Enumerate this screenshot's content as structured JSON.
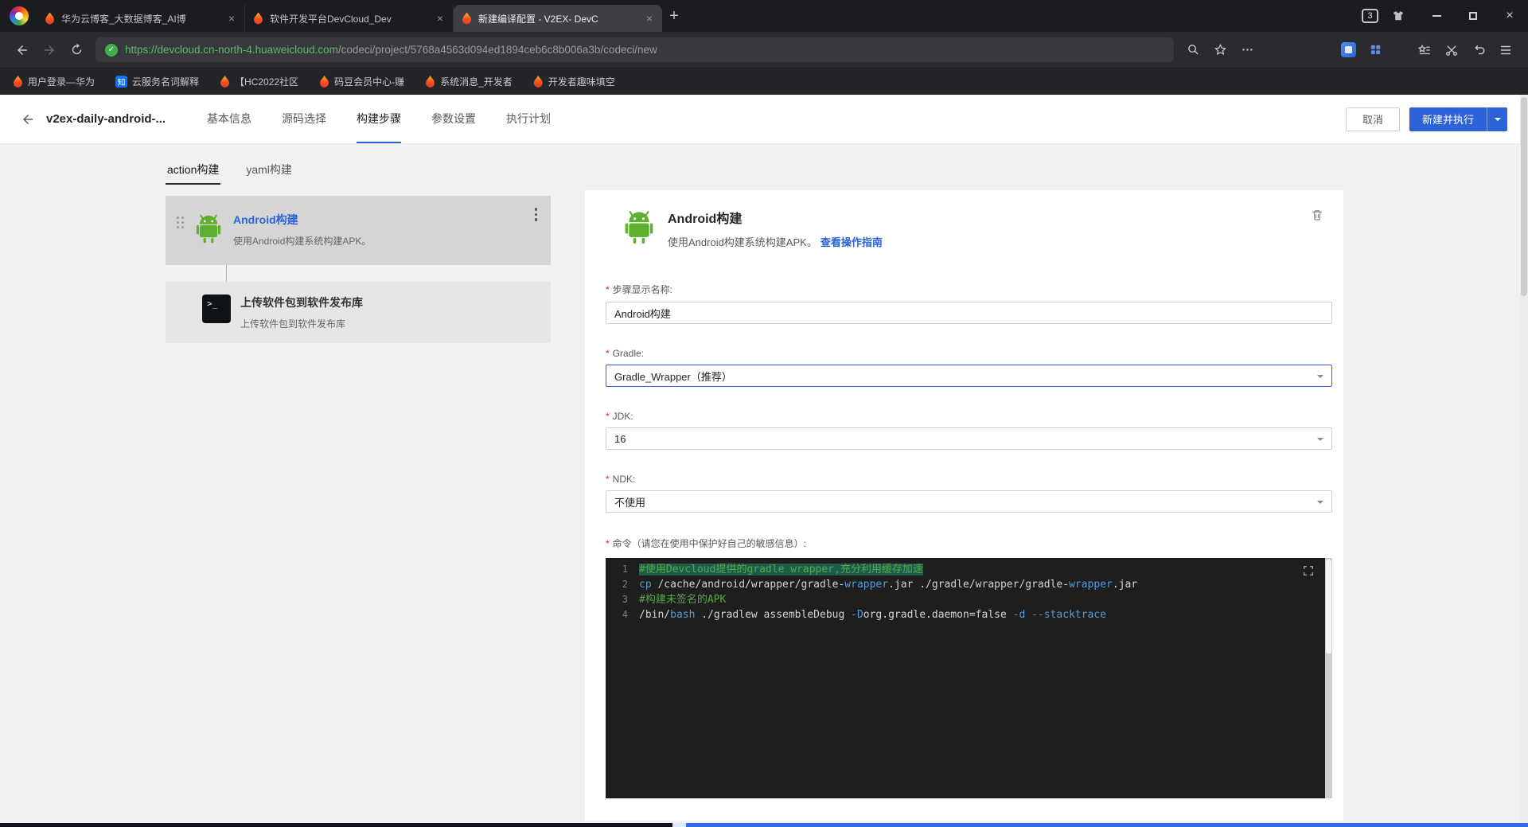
{
  "browser": {
    "tabs": [
      {
        "title": "华为云博客_大数据博客_AI博"
      },
      {
        "title": "软件开发平台DevCloud_Dev"
      },
      {
        "title": "新建编译配置 - V2EX- DevC"
      }
    ],
    "new_tab_label": "+",
    "tab_count_badge": "3",
    "url_secure": "https://devcloud.cn-north-4.huaweicloud.com",
    "url_path": "/codeci/project/5768a4563d094ed1894ceb6c8b006a3b/codeci/new",
    "bookmarks": [
      {
        "label": "用户登录—华为"
      },
      {
        "label": "云服务名词解释",
        "badge": "知"
      },
      {
        "label": "【HC2022社区"
      },
      {
        "label": "码豆会员中心-赚"
      },
      {
        "label": "系统消息_开发者"
      },
      {
        "label": "开发者趣味填空"
      }
    ]
  },
  "page": {
    "header": {
      "title": "v2ex-daily-android-...",
      "nav_tabs": [
        {
          "label": "基本信息"
        },
        {
          "label": "源码选择"
        },
        {
          "label": "构建步骤"
        },
        {
          "label": "参数设置"
        },
        {
          "label": "执行计划"
        }
      ],
      "cancel_label": "取消",
      "primary_label": "新建并执行"
    },
    "mode_tabs": [
      {
        "label": "action构建"
      },
      {
        "label": "yaml构建"
      }
    ],
    "steps": [
      {
        "title": "Android构建",
        "desc": "使用Android构建系统构建APK。"
      },
      {
        "title": "上传软件包到软件发布库",
        "desc": "上传软件包到软件发布库"
      }
    ],
    "detail": {
      "title": "Android构建",
      "desc": "使用Android构建系统构建APK。",
      "guide_link": "查看操作指南",
      "fields": {
        "name": {
          "label": "步骤显示名称:",
          "value": "Android构建"
        },
        "gradle": {
          "label": "Gradle:",
          "value": "Gradle_Wrapper（推荐）"
        },
        "jdk": {
          "label": "JDK:",
          "value": "16"
        },
        "ndk": {
          "label": "NDK:",
          "value": "不使用"
        },
        "command": {
          "label": "命令（请您在使用中保护好自己的敏感信息）:"
        }
      },
      "editor": {
        "lines": [
          {
            "num": "1",
            "segments": [
              {
                "t": "#使用Devcloud提供的gradle wrapper,充分利用缓存加速",
                "c": "cm",
                "sel": true
              }
            ]
          },
          {
            "num": "2",
            "segments": [
              {
                "t": "cp ",
                "c": "kw"
              },
              {
                "t": "/cache/android/wrapper/gradle-",
                "c": "pl"
              },
              {
                "t": "wrapper",
                "c": "kw"
              },
              {
                "t": ".jar ./gradle/wrapper/gradle-",
                "c": "pl"
              },
              {
                "t": "wrapper",
                "c": "kw"
              },
              {
                "t": ".jar",
                "c": "pl"
              }
            ]
          },
          {
            "num": "3",
            "segments": [
              {
                "t": "#构建未签名的APK",
                "c": "cm"
              }
            ]
          },
          {
            "num": "4",
            "segments": [
              {
                "t": "/bin/",
                "c": "pl"
              },
              {
                "t": "bash",
                "c": "kw"
              },
              {
                "t": " ./gradlew assembleDebug ",
                "c": "pl"
              },
              {
                "t": "-D",
                "c": "kw"
              },
              {
                "t": "org.gradle.daemon=false ",
                "c": "pl"
              },
              {
                "t": "-d",
                "c": "kw"
              },
              {
                "t": " ",
                "c": "pl"
              },
              {
                "t": "--stacktrace",
                "c": "kw"
              }
            ]
          }
        ]
      }
    }
  },
  "colors": {
    "accent_blue": "#2d63d8",
    "secure_green": "#3fae4b",
    "editor_comment": "#57a64a",
    "editor_keyword": "#569cd6"
  }
}
